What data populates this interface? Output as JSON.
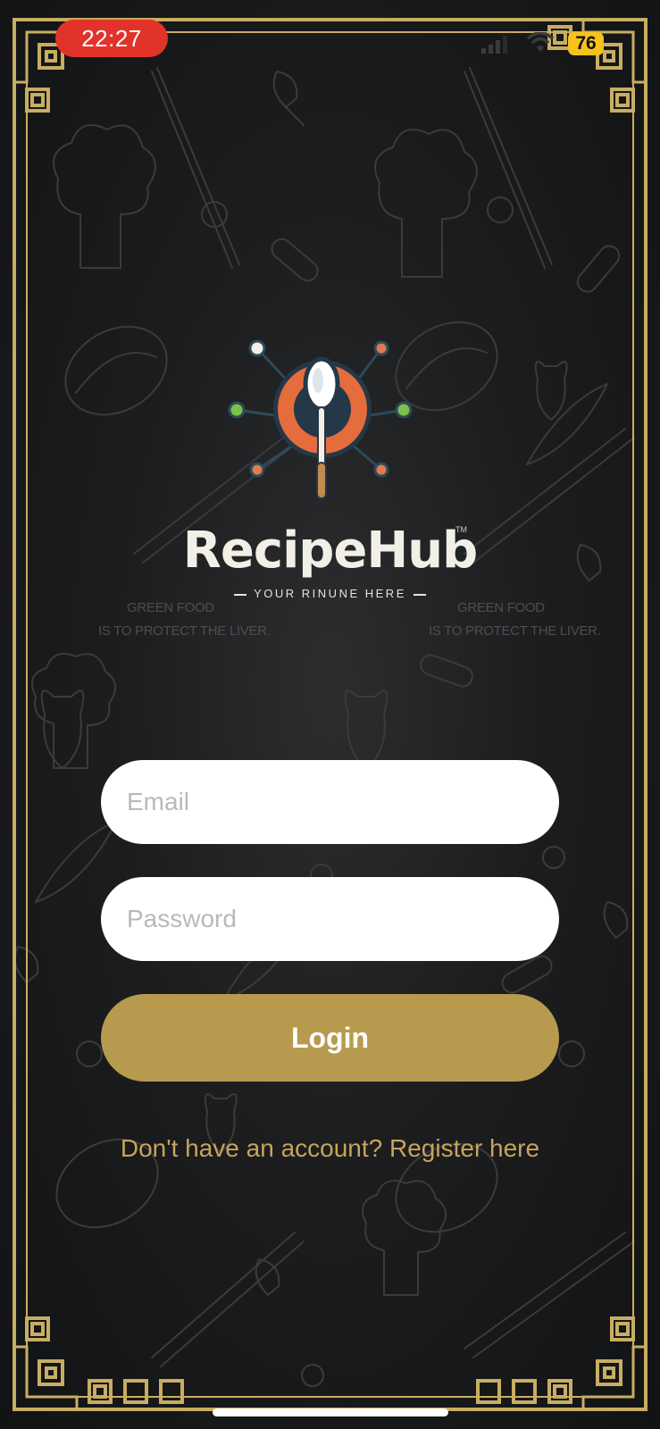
{
  "status_bar": {
    "time": "22:27",
    "battery": "76",
    "icons": [
      "signal-icon",
      "wifi-icon",
      "battery-icon"
    ],
    "time_pill_color": "#e2332b",
    "battery_color": "#f7c21a"
  },
  "logo": {
    "name": "RecipeHub",
    "trademark": "TM",
    "tagline": "YOUR RINUNE HERE",
    "icon": "spoon-logo-icon"
  },
  "background": {
    "watermark_lines": [
      "GREEN FOOD",
      "IS TO PROTECT THE LIVER."
    ]
  },
  "form": {
    "email_placeholder": "Email",
    "password_placeholder": "Password",
    "login_label": "Login",
    "register_text": "Don't have an account? Register here"
  },
  "colors": {
    "accent_gold": "#b89a4e",
    "link_gold": "#c6a45a",
    "frame_gold": "#c8ad62",
    "background": "#1c1d1f"
  }
}
